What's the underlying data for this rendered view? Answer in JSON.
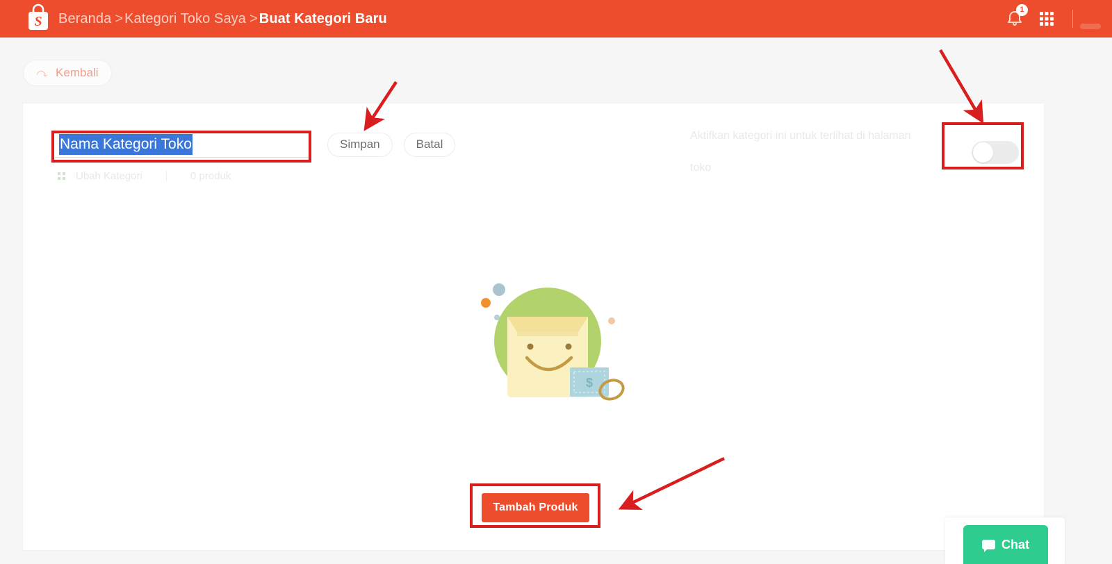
{
  "header": {
    "logo_icon": "shopee-bag-logo",
    "breadcrumb": {
      "items": [
        "Beranda",
        "Kategori Toko Saya"
      ],
      "separator": ">",
      "current": "Buat Kategori Baru"
    },
    "notification_icon": "bell-icon",
    "notification_count": "1",
    "apps_icon": "grid-apps-icon",
    "accent_color": "#ee4d2d"
  },
  "back_button": {
    "label": "Kembali",
    "icon": "back-arrow-icon"
  },
  "category_form": {
    "name_input": {
      "value": "Nama Kategori Toko",
      "placeholder": "Nama Kategori Toko",
      "selected": true,
      "selection_color": "#3a77d8"
    },
    "save_label": "Simpan",
    "cancel_label": "Batal",
    "meta": {
      "edit_icon": "grid-small-icon",
      "edit_label": "Ubah Kategori",
      "product_count": "0 produk"
    }
  },
  "activate": {
    "description": "Aktifkan kategori ini untuk terlihat di halaman toko",
    "toggle_state": "off"
  },
  "empty_state": {
    "illustration": "smiling-shopping-bag-with-price-tag",
    "add_product_label": "Tambah Produk",
    "add_product_color": "#ee4d2d"
  },
  "chat_widget": {
    "label": "Chat",
    "icon": "chat-bubble-icon",
    "color": "#2ecc8f"
  },
  "annotations": {
    "color": "#d81e1e",
    "boxes": [
      "name-input",
      "activate-toggle",
      "add-product-button"
    ],
    "arrows": [
      "arrow-to-save-button",
      "arrow-to-activate-toggle",
      "arrow-to-add-product"
    ]
  }
}
